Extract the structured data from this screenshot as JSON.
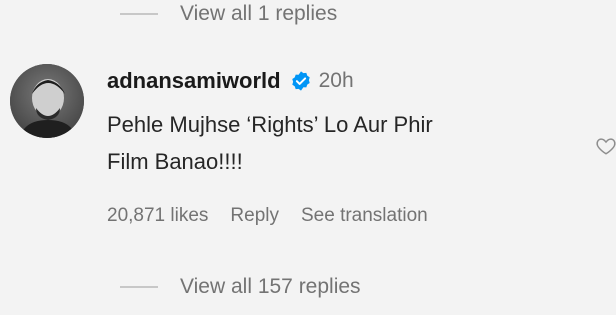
{
  "replies_top": {
    "label": "View all 1 replies"
  },
  "comment": {
    "username": "adnansamiworld",
    "verified": true,
    "time": "20h",
    "text_line1": "Pehle Mujhse ‘Rights’ Lo Aur Phir",
    "text_line2": "Film Banao!!!!",
    "likes": "20,871 likes",
    "reply_label": "Reply",
    "translate_label": "See translation"
  },
  "replies_bottom": {
    "label": "View all 157 replies"
  },
  "icons": {
    "verified": "verified-badge-icon",
    "like": "heart-icon"
  },
  "colors": {
    "verified_blue": "#0095f6",
    "muted_text": "#737373"
  }
}
